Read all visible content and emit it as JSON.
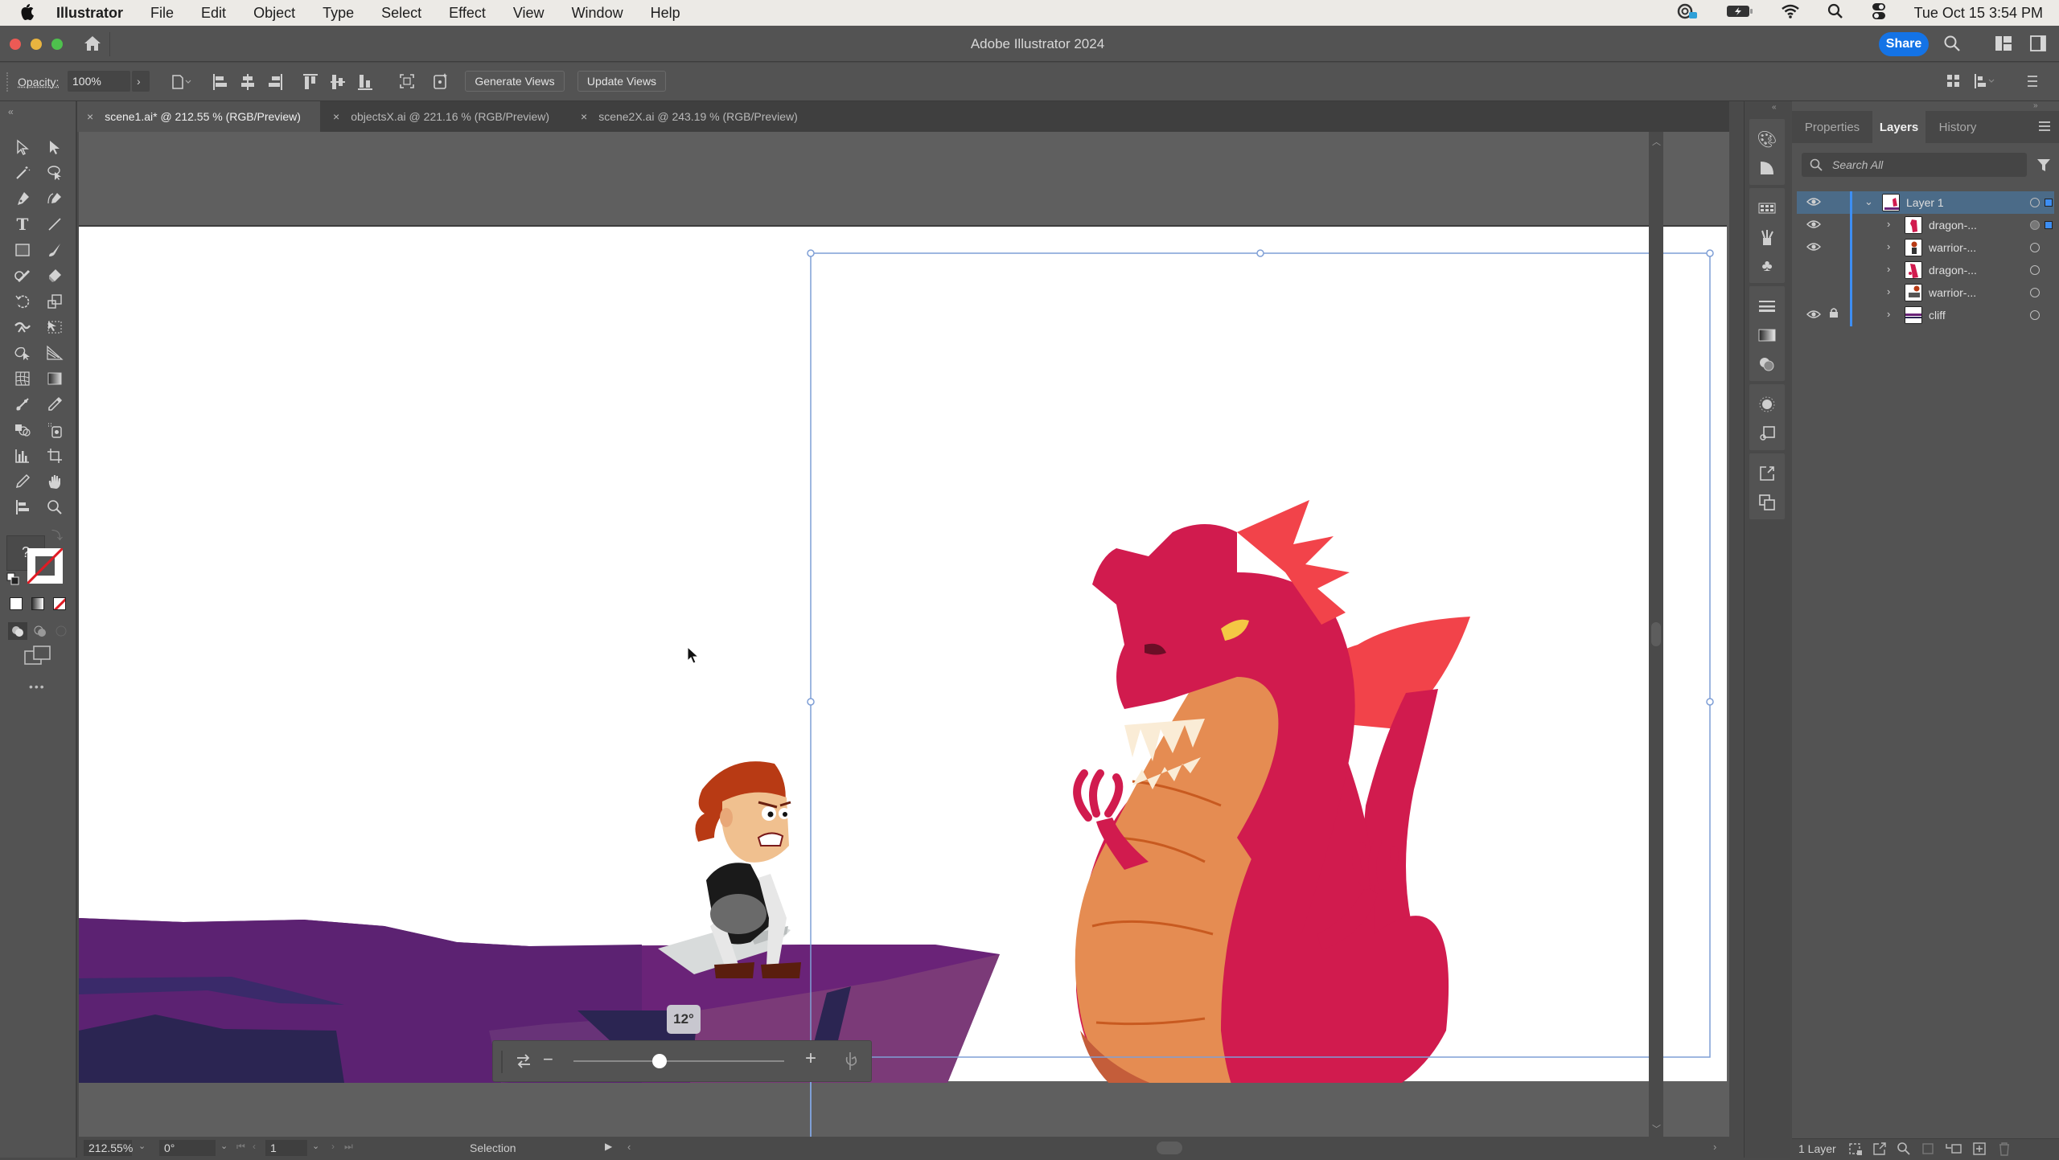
{
  "menubar": {
    "app_name": "Illustrator",
    "items": [
      "File",
      "Edit",
      "Object",
      "Type",
      "Select",
      "Effect",
      "View",
      "Window",
      "Help"
    ],
    "status_icons": [
      "creative-cloud-icon",
      "battery-icon",
      "wifi-icon",
      "spotlight-search-icon",
      "control-center-icon"
    ],
    "datetime": "Tue Oct 15  3:54 PM"
  },
  "titlebar": {
    "title": "Adobe Illustrator 2024",
    "share_label": "Share"
  },
  "controlbar": {
    "opacity_label": "Opacity:",
    "opacity_value": "100%",
    "generate_views_label": "Generate Views",
    "update_views_label": "Update Views"
  },
  "tabs": [
    {
      "label": "scene1.ai* @ 212.55 % (RGB/Preview)",
      "active": true
    },
    {
      "label": "objectsX.ai @ 221.16 % (RGB/Preview)",
      "active": false
    },
    {
      "label": "scene2X.ai @ 243.19 % (RGB/Preview)",
      "active": false
    }
  ],
  "tools": [
    "selection-tool",
    "direct-selection-tool",
    "magic-wand-tool",
    "lasso-tool",
    "pen-tool",
    "curvature-tool",
    "type-tool",
    "line-segment-tool",
    "rectangle-tool",
    "paintbrush-tool",
    "shaper-tool",
    "eraser-tool",
    "rotate-tool",
    "scale-tool",
    "puppet-warp-tool",
    "free-transform-tool",
    "shape-builder-tool",
    "perspective-grid-tool",
    "mesh-tool",
    "gradient-tool",
    "measure-tool",
    "eyedropper-tool",
    "blend-tool",
    "symbol-sprayer-tool",
    "column-graph-tool",
    "artboard-tool",
    "pencil-tool",
    "hand-tool",
    "align-tool",
    "zoom-tool"
  ],
  "color_controls": {
    "fill_unknown_label": "?",
    "more_label": "•••"
  },
  "rotate_widget": {
    "angle_label": "12°",
    "minus_label": "−",
    "plus_label": "+",
    "slider_value": 0.41
  },
  "statusbar": {
    "zoom": "212.55%",
    "rotation": "0°",
    "artboard_number": "1",
    "tool_name": "Selection"
  },
  "panel": {
    "tabs": [
      {
        "label": "Properties",
        "active": false
      },
      {
        "label": "Layers",
        "active": true
      },
      {
        "label": "History",
        "active": false
      }
    ],
    "search_placeholder": "Search All",
    "layers": [
      {
        "name": "Layer 1",
        "visible": true,
        "locked": false,
        "expanded": true,
        "level": 0,
        "selected": true
      },
      {
        "name": "dragon-...",
        "visible": true,
        "locked": false,
        "expanded": false,
        "level": 1,
        "selected": true
      },
      {
        "name": "warrior-...",
        "visible": true,
        "locked": false,
        "expanded": false,
        "level": 1,
        "selected": false
      },
      {
        "name": "dragon-...",
        "visible": false,
        "locked": false,
        "expanded": false,
        "level": 1,
        "selected": false
      },
      {
        "name": "warrior-...",
        "visible": false,
        "locked": false,
        "expanded": false,
        "level": 1,
        "selected": false
      },
      {
        "name": "cliff",
        "visible": true,
        "locked": true,
        "expanded": false,
        "level": 1,
        "selected": false
      }
    ],
    "footer_count": "1 Layer"
  },
  "colors": {
    "accent": "#1473e6",
    "selection": "#3d8ef3",
    "dragon_body": "#d11b4e",
    "dragon_belly": "#e58c52",
    "dragon_crest": "#f2434a",
    "cliff_purple": "#6a2378",
    "cliff_shadow": "#2b2552"
  }
}
